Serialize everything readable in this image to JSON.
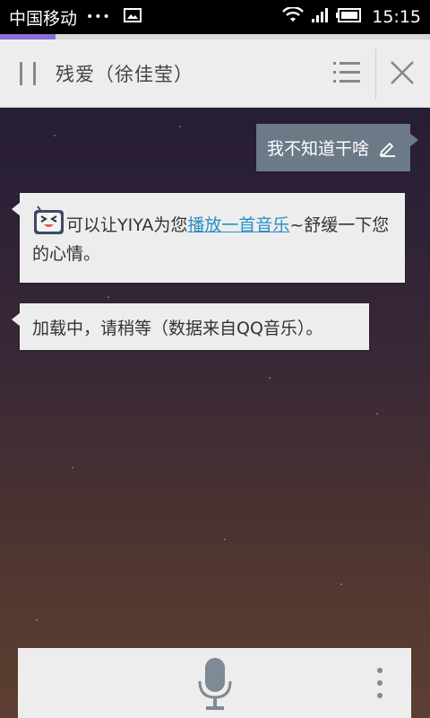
{
  "status_bar": {
    "carrier": "中国移动",
    "dots": "•••",
    "time": "15:15",
    "icons": [
      "gallery-icon",
      "wifi-icon",
      "signal-icon",
      "battery-icon"
    ]
  },
  "progress": {
    "fraction": 0.13,
    "color": "#8a6fd6"
  },
  "header": {
    "song_title": "残爱（徐佳莹）",
    "icons": [
      "pause-icon",
      "list-icon",
      "close-icon"
    ]
  },
  "chat": {
    "user_message": "我不知道干啥",
    "bot_message_1": {
      "before_link": "可以让YIYA为您",
      "link": "播放一首音乐",
      "after_link": "~舒缓一下您的心情。"
    },
    "bot_message_2": "加载中，请稍等（数据来自QQ音乐）。"
  },
  "bottom_bar": {
    "icons": [
      "microphone-icon",
      "more-icon"
    ]
  },
  "colors": {
    "user_bubble": "#6c7a87",
    "bot_bubble": "#ededed",
    "link": "#2a8fc8"
  }
}
